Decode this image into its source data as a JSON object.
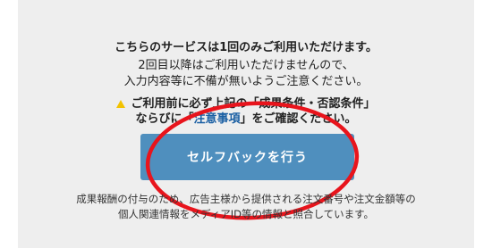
{
  "notice": {
    "line1": "こちらのサービスは1回のみご利用いただけます。",
    "line2": "2回目以降はご利用いただけませんので、",
    "line3": "入力内容等に不備が無いようご注意ください。"
  },
  "warning": {
    "prefix": "ご利用前に必ず上記の",
    "conditions_link": "「成果条件・否認条件」",
    "middle": "ならびに",
    "notes_open": "「",
    "notes_link": "注意事項",
    "notes_close": "」をご確認ください。"
  },
  "cta": {
    "label": "セルフバックを行う"
  },
  "footer": {
    "line1": "成果報酬の付与のため、広告主様から提供される注文番号や注文金額等の",
    "line2": "個人関連情報をメディアID等の情報と照合しています。"
  },
  "colors": {
    "panel": "#eeeeee",
    "button": "#4f8fbe",
    "annotation": "#e8141c",
    "link": "#1a5fa3"
  }
}
